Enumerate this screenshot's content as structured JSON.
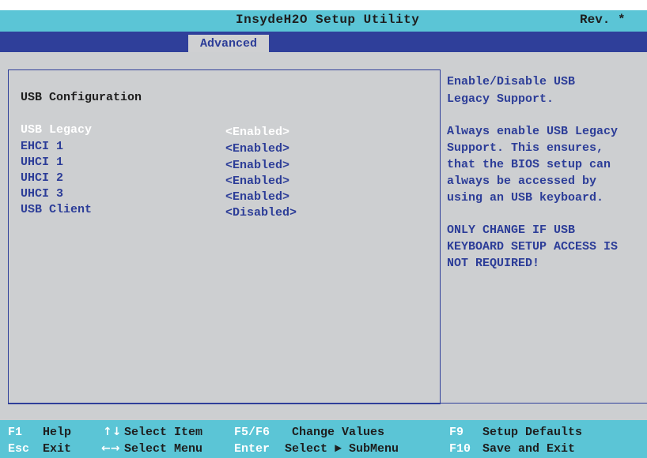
{
  "titlebar": {
    "title": "InsydeH2O Setup Utility",
    "rev": "Rev. *"
  },
  "tabs": [
    {
      "label": "Advanced"
    }
  ],
  "main": {
    "section_title": "USB Configuration",
    "items": [
      {
        "label": "USB Legacy",
        "value": "<Enabled>"
      },
      {
        "label": "EHCI 1",
        "value": "<Enabled>"
      },
      {
        "label": "UHCI 1",
        "value": "<Enabled>"
      },
      {
        "label": "UHCI 2",
        "value": "<Enabled>"
      },
      {
        "label": "UHCI 3",
        "value": "<Enabled>"
      },
      {
        "label": "USB Client",
        "value": "<Disabled>"
      }
    ]
  },
  "help": {
    "lines": [
      "Enable/Disable USB",
      "Legacy Support.",
      "",
      "Always enable USB Legacy",
      "Support. This ensures,",
      "that the BIOS setup can",
      "always be accessed by",
      "using an USB keyboard.",
      "",
      "ONLY CHANGE IF USB",
      "KEYBOARD SETUP ACCESS IS",
      "NOT REQUIRED!"
    ]
  },
  "footer": {
    "f1_key": "F1",
    "f1_desc": "Help",
    "esc_key": "Esc",
    "esc_desc": "Exit",
    "updown_icon": "↑↓",
    "updown_desc": "Select Item",
    "leftright_icon": "←→",
    "leftright_desc": "Select Menu",
    "f5f6_key": "F5/F6",
    "f5f6_desc": "Change Values",
    "enter_key": "Enter",
    "enter_desc": "Select ► SubMenu",
    "f9_key": "F9",
    "f9_desc": "Setup Defaults",
    "f10_key": "F10",
    "f10_desc": "Save and Exit"
  }
}
